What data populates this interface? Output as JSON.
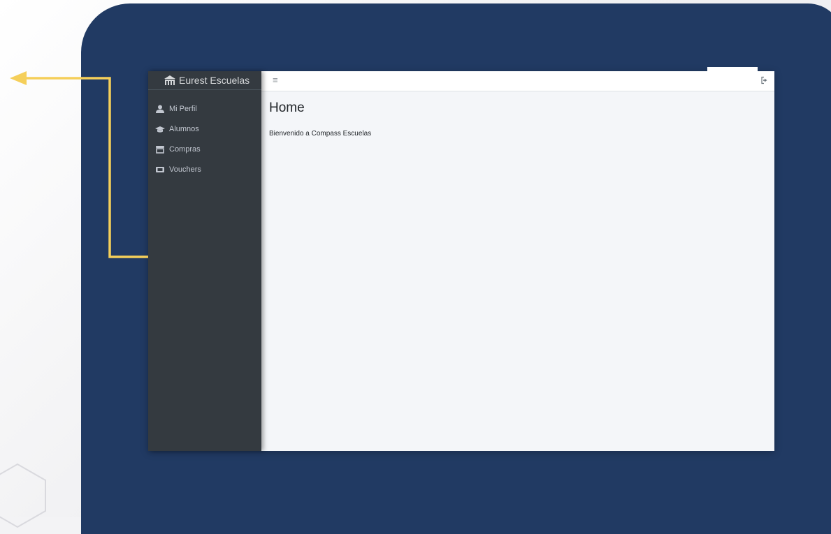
{
  "app": {
    "brand": "Eurest Escuelas",
    "brand_icon": "school-building-icon"
  },
  "sidebar": {
    "items": [
      {
        "label": "Mi Perfil",
        "icon": "user-icon"
      },
      {
        "label": "Alumnos",
        "icon": "graduation-cap-icon"
      },
      {
        "label": "Compras",
        "icon": "store-icon"
      },
      {
        "label": "Vouchers",
        "icon": "ticket-icon"
      }
    ]
  },
  "topbar": {
    "menu_icon": "hamburger-icon",
    "logout_icon": "sign-out-icon"
  },
  "main": {
    "title": "Home",
    "welcome": "Bienvenido a Compass Escuelas"
  },
  "colors": {
    "navy_panel": "#213a63",
    "sidebar": "#343a40",
    "content_bg": "#f4f6f9",
    "annotation_arrow": "#f5cf5a"
  }
}
